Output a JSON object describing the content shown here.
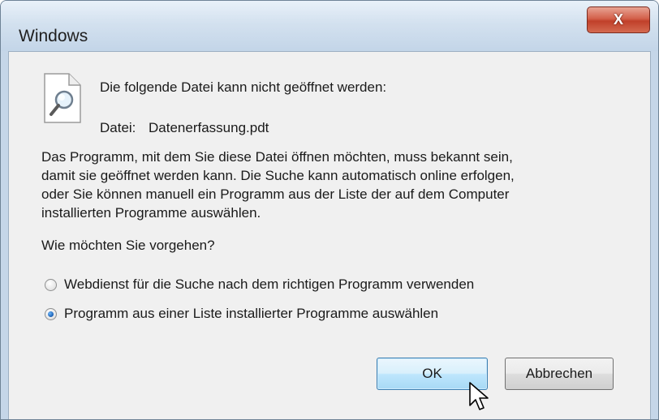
{
  "window": {
    "title": "Windows",
    "close_symbol": "X"
  },
  "dialog": {
    "icon": "magnifier-document-icon",
    "heading": "Die folgende Datei kann nicht geöffnet werden:",
    "file_label": "Datei:",
    "file_name": "Datenerfassung.pdt",
    "description": [
      "Das Programm, mit dem Sie diese Datei öffnen möchten, muss bekannt sein,",
      "damit sie geöffnet werden kann. Die Suche kann automatisch online erfolgen,",
      "oder Sie können manuell ein Programm aus der Liste der auf dem Computer",
      "installierten Programme auswählen."
    ],
    "question": "Wie möchten Sie vorgehen?",
    "options": [
      {
        "label": "Webdienst für die Suche nach dem richtigen Programm verwenden",
        "selected": false
      },
      {
        "label": "Programm aus einer Liste installierter Programme auswählen",
        "selected": true
      }
    ],
    "ok_label": "OK",
    "cancel_label": "Abbrechen"
  },
  "colors": {
    "title_bar": "#c5d6e8",
    "close_button": "#c0402a",
    "dialog_body": "#f0f0f0",
    "ok_button_accent": "#3c7fb1",
    "radio_selected": "#1a5fb4"
  }
}
